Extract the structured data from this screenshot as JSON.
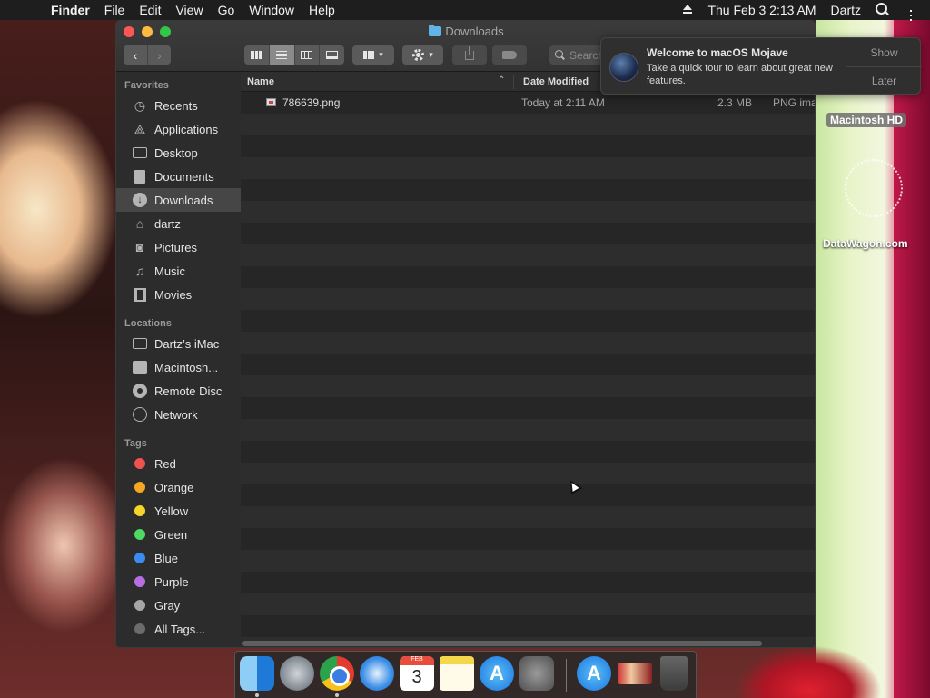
{
  "menubar": {
    "apple_icon": "apple-icon",
    "app_name": "Finder",
    "items": [
      "File",
      "Edit",
      "View",
      "Go",
      "Window",
      "Help"
    ],
    "clock": "Thu Feb 3  2:13 AM",
    "user": "Dartz"
  },
  "window": {
    "title": "Downloads",
    "search_placeholder": "Search"
  },
  "sidebar": {
    "favorites_header": "Favorites",
    "favorites": [
      {
        "label": "Recents",
        "icon": "clock-icon"
      },
      {
        "label": "Applications",
        "icon": "applications-icon"
      },
      {
        "label": "Desktop",
        "icon": "desktop-icon"
      },
      {
        "label": "Documents",
        "icon": "document-icon"
      },
      {
        "label": "Downloads",
        "icon": "download-icon"
      },
      {
        "label": "dartz",
        "icon": "home-icon"
      },
      {
        "label": "Pictures",
        "icon": "camera-icon"
      },
      {
        "label": "Music",
        "icon": "music-note-icon"
      },
      {
        "label": "Movies",
        "icon": "film-icon"
      }
    ],
    "locations_header": "Locations",
    "locations": [
      {
        "label": "Dartz’s iMac",
        "icon": "computer-icon"
      },
      {
        "label": "Macintosh...",
        "icon": "hard-drive-icon"
      },
      {
        "label": "Remote Disc",
        "icon": "disc-icon"
      },
      {
        "label": "Network",
        "icon": "globe-icon"
      }
    ],
    "tags_header": "Tags",
    "tags": [
      {
        "label": "Red",
        "color": "#f0524f"
      },
      {
        "label": "Orange",
        "color": "#f5a623"
      },
      {
        "label": "Yellow",
        "color": "#f8d42b"
      },
      {
        "label": "Green",
        "color": "#4cd964"
      },
      {
        "label": "Blue",
        "color": "#3b8cf0"
      },
      {
        "label": "Purple",
        "color": "#b86ee0"
      },
      {
        "label": "Gray",
        "color": "#a6a6a6"
      },
      {
        "label": "All Tags...",
        "color": "#6b6b6b"
      }
    ]
  },
  "list": {
    "columns": {
      "name": "Name",
      "date": "Date Modified"
    },
    "rows": [
      {
        "name": "786639.png",
        "date": "Today at 2:11 AM",
        "size": "2.3 MB",
        "kind": "PNG ima"
      }
    ]
  },
  "notification": {
    "title": "Welcome to macOS Mojave",
    "body": "Take a quick tour to learn about great new features.",
    "show_label": "Show",
    "later_label": "Later"
  },
  "desktop": {
    "hd_label": "Macintosh HD",
    "watermark": "DataWagon.com"
  },
  "dock": {
    "calendar_month": "FEB",
    "calendar_day": "3"
  }
}
